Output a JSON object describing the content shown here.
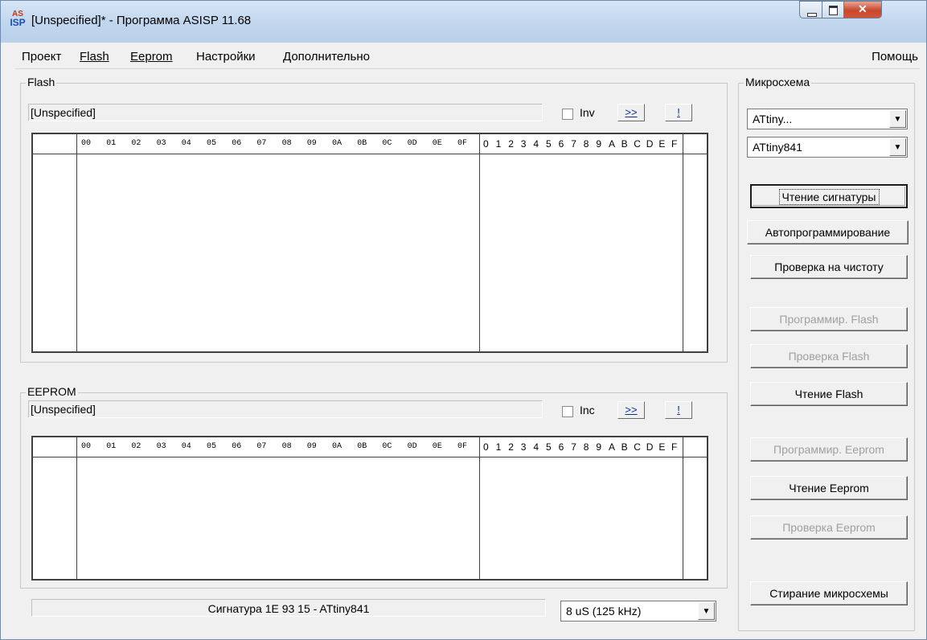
{
  "window": {
    "title": "[Unspecified]* - Программа ASISP 11.68",
    "icon_top": "AS",
    "icon_bottom": "ISP"
  },
  "menu": {
    "items": [
      "Проект",
      "Flash",
      "Eeprom",
      "Настройки",
      "Дополнительно"
    ],
    "help": "Помощь"
  },
  "flash": {
    "legend": "Flash",
    "file": "[Unspecified]",
    "checkbox_label": "Inv",
    "forward_button": ">>",
    "bang_button": "!"
  },
  "eeprom": {
    "legend": "EEPROM",
    "file": "[Unspecified]",
    "checkbox_label": "Inc",
    "forward_button": ">>",
    "bang_button": "!"
  },
  "hex_headers": [
    "00",
    "01",
    "02",
    "03",
    "04",
    "05",
    "06",
    "07",
    "08",
    "09",
    "0A",
    "0B",
    "0C",
    "0D",
    "0E",
    "0F"
  ],
  "ascii_headers": [
    "0",
    "1",
    "2",
    "3",
    "4",
    "5",
    "6",
    "7",
    "8",
    "9",
    "A",
    "B",
    "C",
    "D",
    "E",
    "F"
  ],
  "chip": {
    "legend": "Микросхема",
    "family": "ATtiny...",
    "device": "ATtiny841"
  },
  "buttons": {
    "read_signature": "Чтение сигнатуры",
    "auto_program": "Автопрограммирование",
    "blank_check": "Проверка на чистоту",
    "program_flash": "Программир. Flash",
    "verify_flash": "Проверка Flash",
    "read_flash": "Чтение Flash",
    "program_eeprom": "Программир. Eeprom",
    "read_eeprom": "Чтение Eeprom",
    "verify_eeprom": "Проверка Eeprom",
    "erase_chip": "Стирание микросхемы"
  },
  "status": {
    "signature_text": "Сигнатура 1E 93 15 - ATtiny841",
    "speed": "8 uS  (125 kHz)"
  }
}
